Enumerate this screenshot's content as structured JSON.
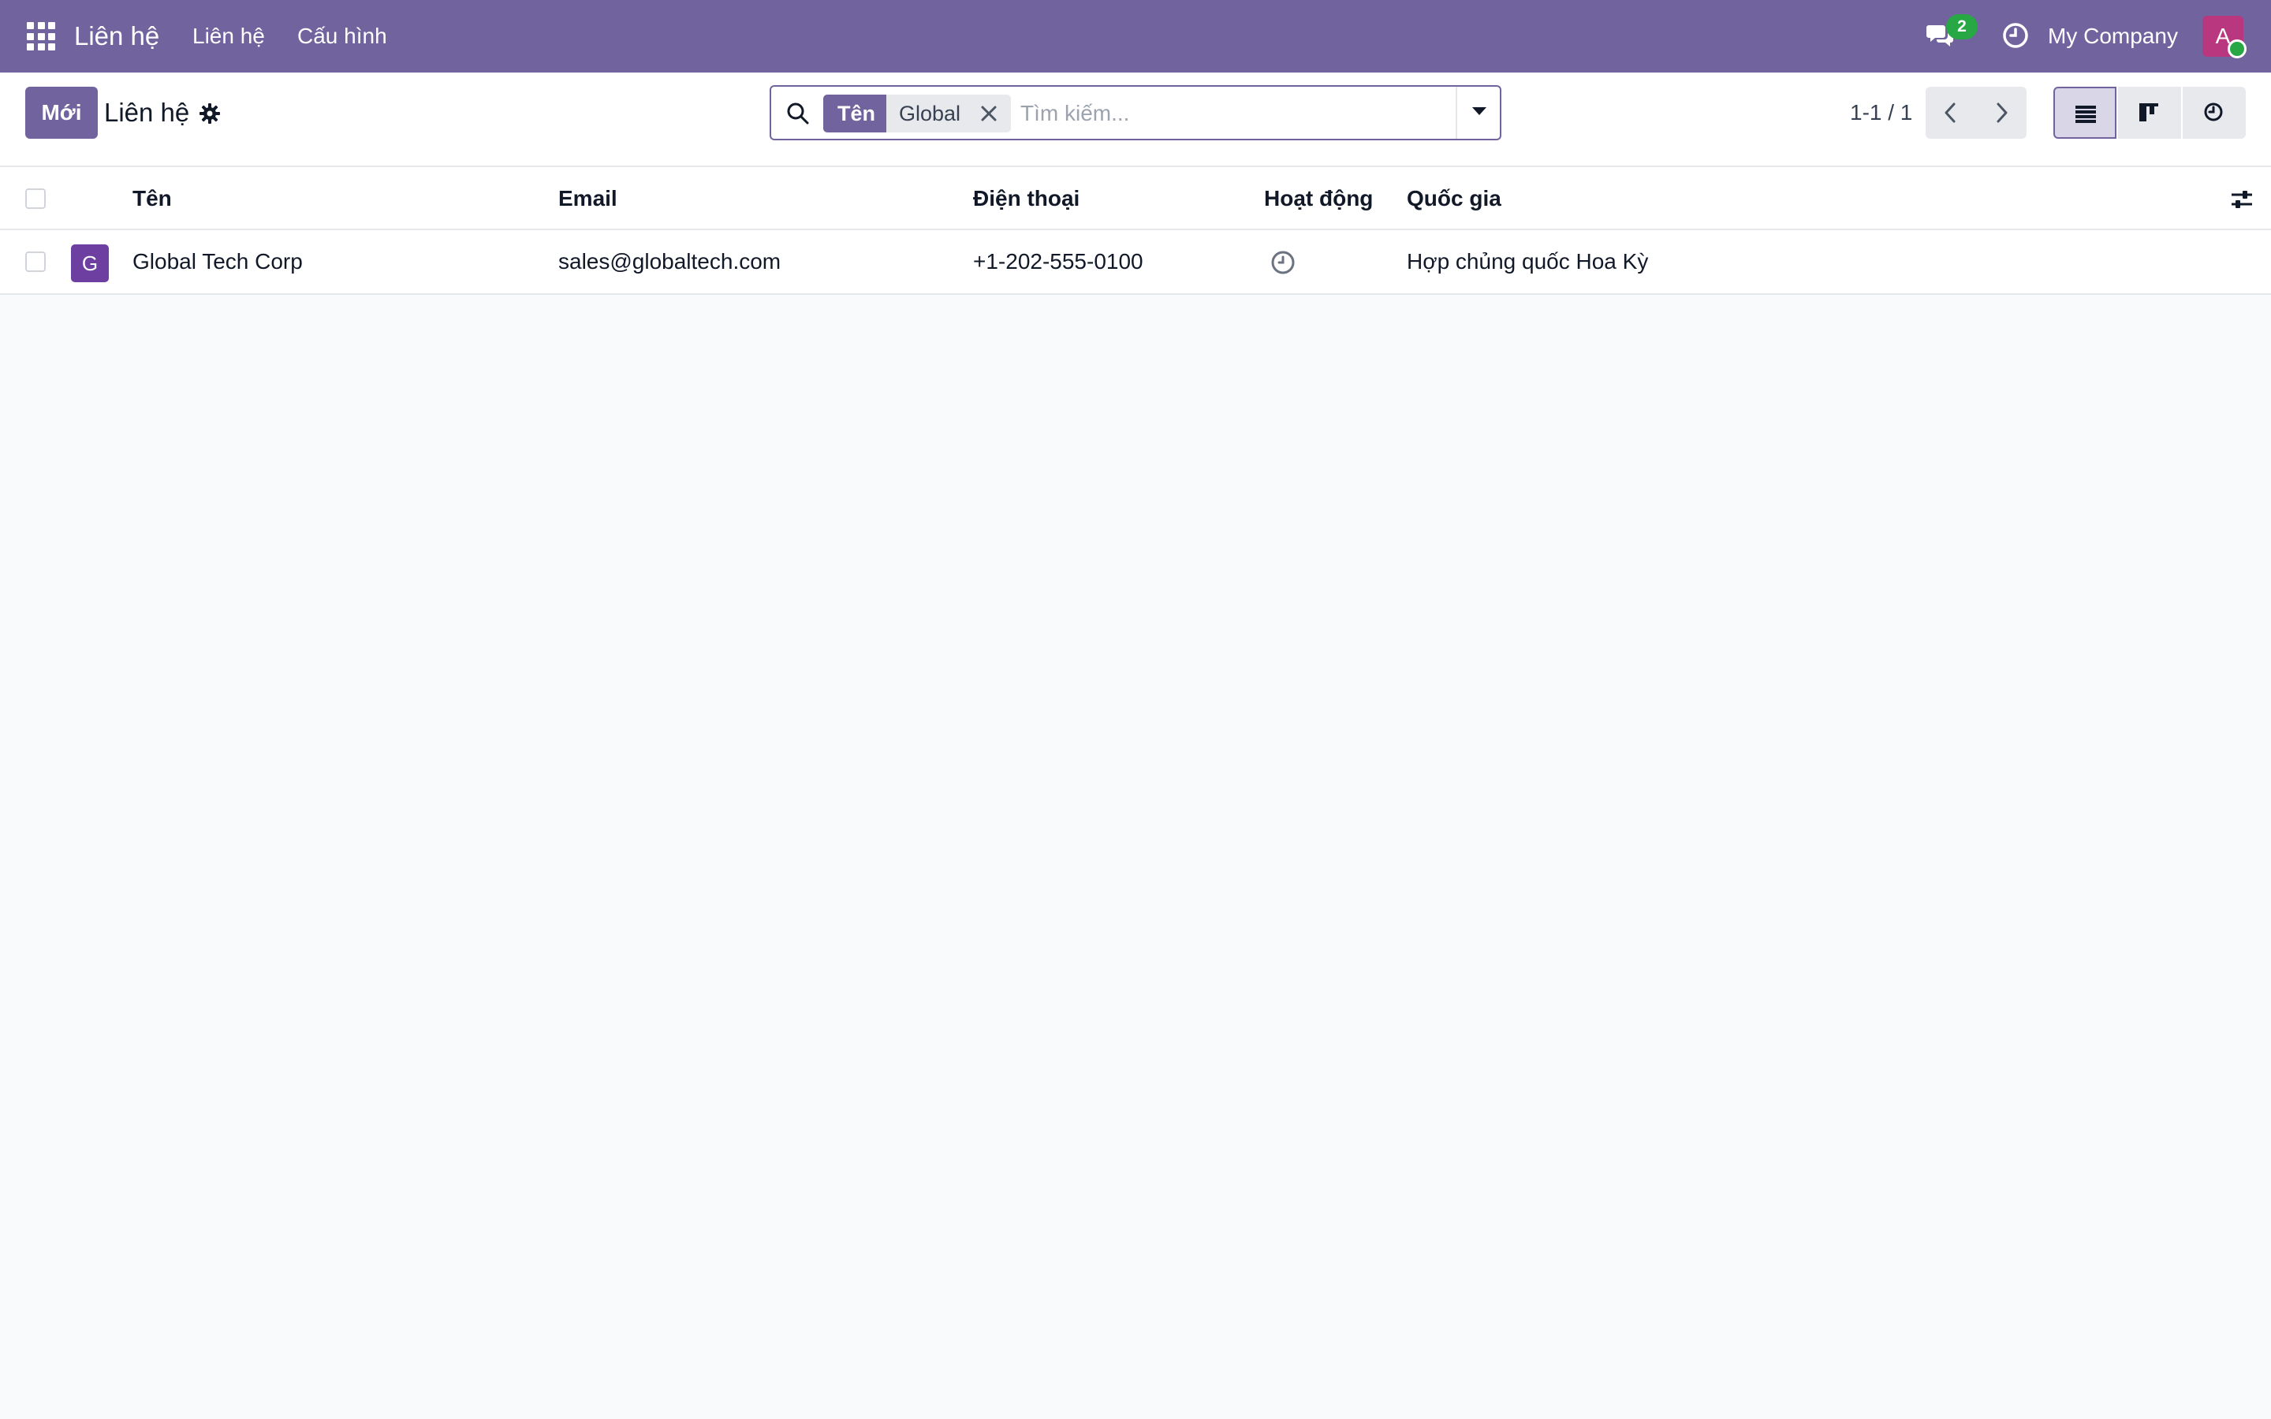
{
  "navbar": {
    "brand": "Liên hệ",
    "menu": [
      {
        "label": "Liên hệ"
      },
      {
        "label": "Cấu hình"
      }
    ],
    "chat_badge": "2",
    "company": "My Company",
    "avatar_initial": "A"
  },
  "control_panel": {
    "new_button": "Mới",
    "title": "Liên hệ",
    "search": {
      "facet_label": "Tên",
      "facet_value": "Global",
      "placeholder": "Tìm kiếm..."
    },
    "pager": "1-1 / 1"
  },
  "table": {
    "columns": [
      "Tên",
      "Email",
      "Điện thoại",
      "Hoạt động",
      "Quốc gia"
    ],
    "rows": [
      {
        "avatar": "G",
        "name": "Global Tech Corp",
        "email": "sales@globaltech.com",
        "phone": "+1-202-555-0100",
        "country": "Hợp chủng quốc Hoa Kỳ"
      }
    ]
  },
  "colors": {
    "brand": "#71639e",
    "badge": "#28a745",
    "avatar": "#b8377f",
    "row_avatar": "#6d3fa0"
  }
}
